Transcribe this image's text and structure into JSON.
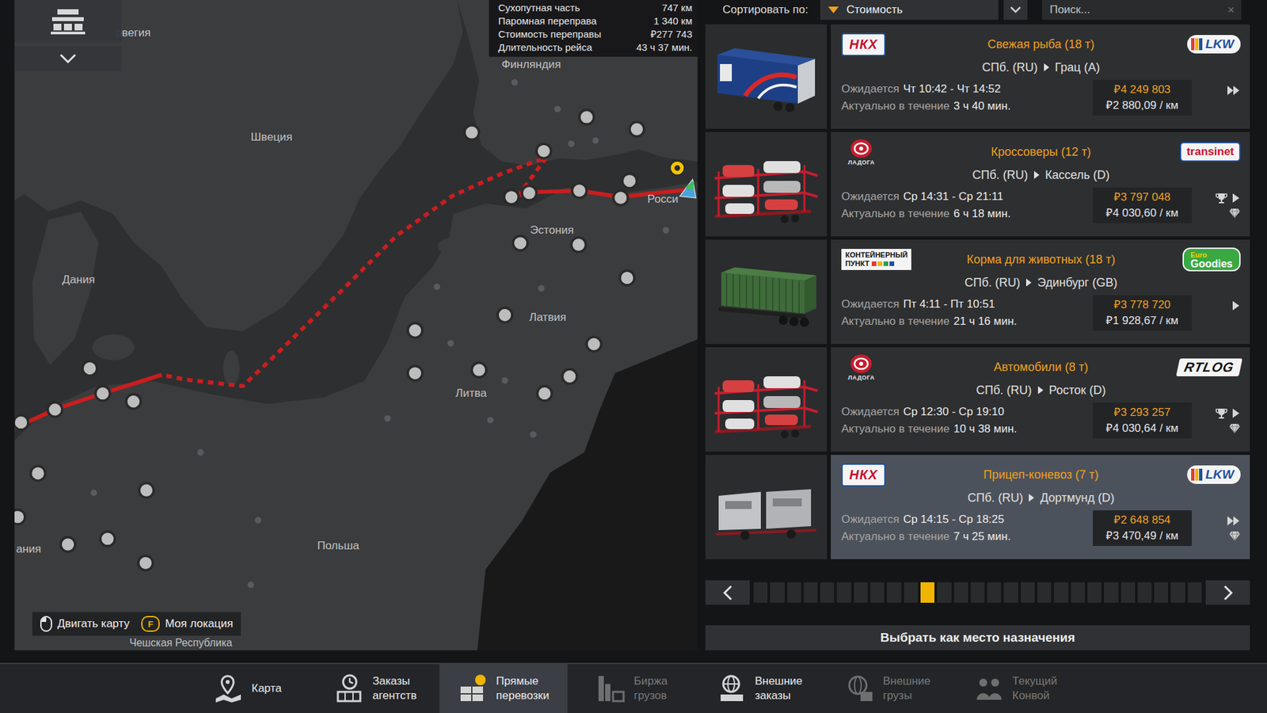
{
  "map": {
    "labels": [
      "рвегия",
      "Финляндия",
      "Швеция",
      "Эстония",
      "Латвия",
      "Литва",
      "Дания",
      "Польша",
      "ания",
      "Росси",
      "Чешская Республика"
    ],
    "route_info": [
      {
        "label": "Сухопутная часть",
        "value": "747 км"
      },
      {
        "label": "Паромная переправа",
        "value": "1 340 км"
      },
      {
        "label": "Стоимость переправы",
        "value": "₽277 743"
      },
      {
        "label": "Длительность рейса",
        "value": "43 ч 37 мин."
      }
    ],
    "hints": [
      {
        "kind": "mouse",
        "label": "Двигать карту"
      },
      {
        "kind": "key",
        "key": "F",
        "label": "Моя локация"
      }
    ]
  },
  "sort": {
    "label": "Сортировать по:",
    "value": "Стоимость"
  },
  "search": {
    "placeholder": "Поиск...",
    "clear": "×"
  },
  "jobs": [
    {
      "source_logo": {
        "kind": "nkh",
        "lines": [
          "НКХ"
        ]
      },
      "cargo": "Свежая рыба (18 т)",
      "from": "СПб. (RU)",
      "to": "Грац (A)",
      "dest_logo": {
        "kind": "lkw",
        "lines": [
          "LKW"
        ]
      },
      "expected_label": "Ожидается",
      "expected": "Чт 10:42 - Чт 14:52",
      "valid_label": "Актуально в течение",
      "valid": "3 ч 40 мин.",
      "price": "₽4 249 803",
      "per_km": "₽2 880,09 / км",
      "image": "reefer",
      "arrow": "double",
      "trophy": false,
      "gem": false,
      "selected": false
    },
    {
      "source_logo": {
        "kind": "ladoga",
        "lines": [
          "ЛАДОГА"
        ]
      },
      "cargo": "Кроссоверы (12 т)",
      "from": "СПб. (RU)",
      "to": "Кассель (D)",
      "dest_logo": {
        "kind": "transinet",
        "lines": [
          "transinet"
        ]
      },
      "expected_label": "Ожидается",
      "expected": "Ср 14:31 - Ср 21:11",
      "valid_label": "Актуально в течение",
      "valid": "6 ч 18 мин.",
      "price": "₽3 797 048",
      "per_km": "₽4 030,60 / км",
      "image": "carcarrier",
      "arrow": "single",
      "trophy": true,
      "gem": true,
      "selected": false
    },
    {
      "source_logo": {
        "kind": "kp",
        "lines": [
          "КОНТЕЙНЕРНЫЙ",
          "ПУНКТ"
        ]
      },
      "cargo": "Корма для животных (18 т)",
      "from": "СПб. (RU)",
      "to": "Эдинбург (GB)",
      "dest_logo": {
        "kind": "eg",
        "lines": [
          "Euro",
          "Goodies"
        ]
      },
      "expected_label": "Ожидается",
      "expected": "Пт 4:11 - Пт 10:51",
      "valid_label": "Актуально в течение",
      "valid": "21 ч 16 мин.",
      "price": "₽3 778 720",
      "per_km": "₽1 928,67 / км",
      "image": "container",
      "arrow": "single",
      "trophy": false,
      "gem": false,
      "selected": false
    },
    {
      "source_logo": {
        "kind": "ladoga",
        "lines": [
          "ЛАДОГА"
        ]
      },
      "cargo": "Автомобили (8 т)",
      "from": "СПб. (RU)",
      "to": "Росток (D)",
      "dest_logo": {
        "kind": "rtlog",
        "lines": [
          "RTLOG"
        ]
      },
      "expected_label": "Ожидается",
      "expected": "Ср 12:30 - Ср 19:10",
      "valid_label": "Актуально в течение",
      "valid": "10 ч 38 мин.",
      "price": "₽3 293 257",
      "per_km": "₽4 030,64 / км",
      "image": "carcarrier",
      "arrow": "single",
      "trophy": true,
      "gem": true,
      "selected": false
    },
    {
      "source_logo": {
        "kind": "nkh",
        "lines": [
          "НКХ"
        ]
      },
      "cargo": "Прицеп-коневоз (7 т)",
      "from": "СПб. (RU)",
      "to": "Дортмунд (D)",
      "dest_logo": {
        "kind": "lkw",
        "lines": [
          "LKW"
        ]
      },
      "expected_label": "Ожидается",
      "expected": "Ср 14:15 - Ср 18:25",
      "valid_label": "Актуально в течение",
      "valid": "7 ч 25 мин.",
      "price": "₽2 648 854",
      "per_km": "₽3 470,49 / км",
      "image": "horsebox",
      "arrow": "double",
      "trophy": false,
      "gem": true,
      "selected": true
    }
  ],
  "pagination": {
    "pages": [
      {
        "selected": false
      },
      {
        "selected": false
      },
      {
        "selected": false
      },
      {
        "selected": false
      },
      {
        "selected": false
      },
      {
        "selected": false
      },
      {
        "selected": false
      },
      {
        "selected": false
      },
      {
        "selected": false
      },
      {
        "selected": false
      },
      {
        "selected": true
      },
      {
        "selected": false
      },
      {
        "selected": false
      },
      {
        "selected": false
      },
      {
        "selected": false
      },
      {
        "selected": false
      },
      {
        "selected": false
      },
      {
        "selected": false
      },
      {
        "selected": false
      },
      {
        "selected": false
      },
      {
        "selected": false
      },
      {
        "selected": false
      },
      {
        "selected": false
      },
      {
        "selected": false
      },
      {
        "selected": false
      },
      {
        "selected": false
      },
      {
        "selected": false
      }
    ]
  },
  "action": {
    "label": "Выбрать как место назначения"
  },
  "nav": [
    {
      "kind": "map",
      "lines": [
        "Карта"
      ],
      "selected": false,
      "disabled": false
    },
    {
      "kind": "agency",
      "lines": [
        "Заказы",
        "агентств"
      ],
      "selected": false,
      "disabled": false
    },
    {
      "kind": "direct",
      "lines": [
        "Прямые",
        "перевозки"
      ],
      "selected": true,
      "disabled": false
    },
    {
      "kind": "market",
      "lines": [
        "Биржа",
        "грузов"
      ],
      "selected": false,
      "disabled": true
    },
    {
      "kind": "external",
      "lines": [
        "Внешние",
        "заказы"
      ],
      "selected": false,
      "disabled": false
    },
    {
      "kind": "cargo",
      "lines": [
        "Внешние",
        "грузы"
      ],
      "selected": false,
      "disabled": true
    },
    {
      "kind": "convoy",
      "lines": [
        "Текущий",
        "Конвой"
      ],
      "selected": false,
      "disabled": true
    }
  ]
}
